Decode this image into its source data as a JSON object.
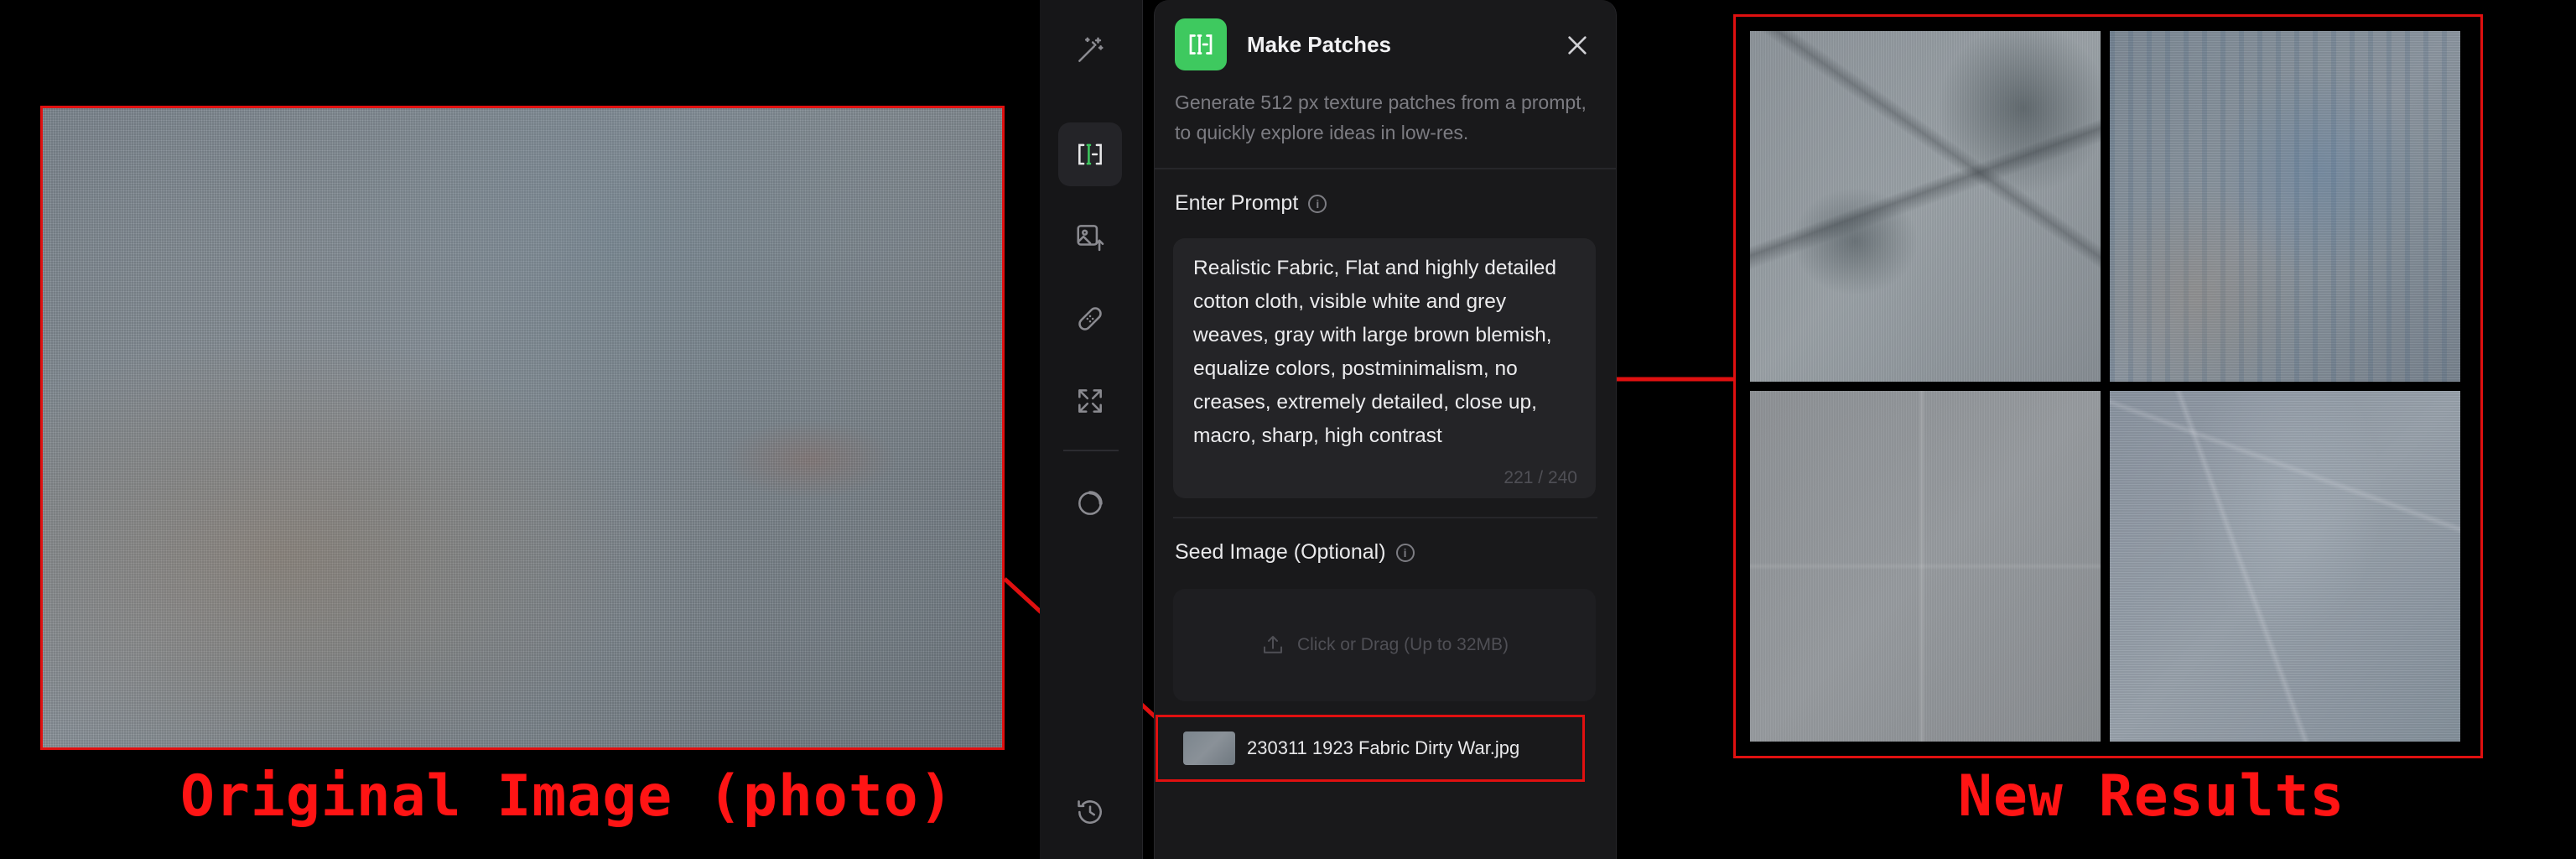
{
  "captions": {
    "left": "Original Image (photo)",
    "right": "New Results"
  },
  "rail": {
    "items": [
      {
        "icon": "magic-wand-icon",
        "active": false
      },
      {
        "icon": "make-patches-icon",
        "active": true
      },
      {
        "icon": "image-upload-icon",
        "active": false
      },
      {
        "icon": "bandage-icon",
        "active": false
      },
      {
        "icon": "expand-icon",
        "active": false
      },
      {
        "icon": "circle-progress-icon",
        "active": false
      },
      {
        "icon": "history-icon",
        "active": false
      }
    ]
  },
  "panel": {
    "title": "Make Patches",
    "description": "Generate 512 px texture patches from a prompt, to quickly explore ideas in low-res.",
    "prompt_label": "Enter Prompt",
    "prompt_value": "Realistic Fabric, Flat and highly detailed cotton cloth, visible white and grey weaves, gray with large brown blemish, equalize colors, postminimalism, no creases, extremely detailed, close up, macro, sharp, high contrast",
    "char_count": "221 / 240",
    "seed_label": "Seed Image (Optional)",
    "dropzone_text": "Click or Drag (Up to 32MB)",
    "file_name": "230311 1923 Fabric Dirty War.jpg"
  },
  "colors": {
    "accent_green": "#3ec95f",
    "annotation_red": "#e01010",
    "panel_bg": "#19191b",
    "rail_bg": "#161618"
  }
}
